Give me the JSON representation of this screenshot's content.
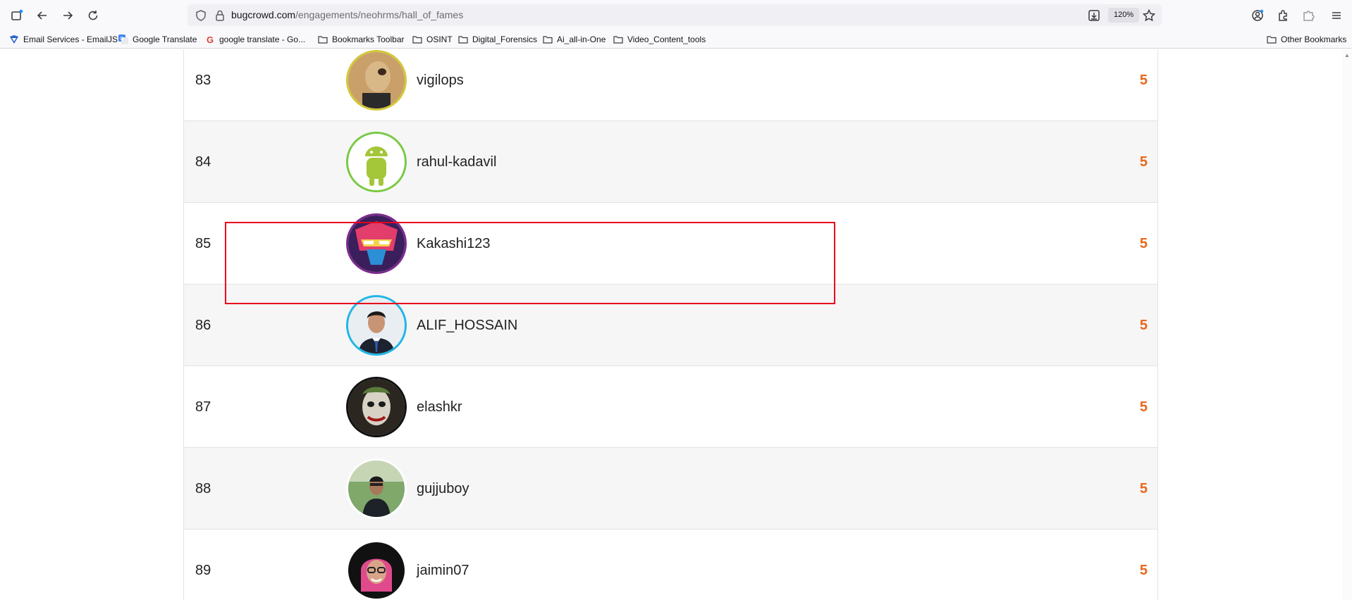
{
  "browser": {
    "url_host": "bugcrowd.com",
    "url_path": "/engagements/neohrms/hall_of_fames",
    "zoom": "120%"
  },
  "bookmarks": [
    {
      "label": "Email Services - EmailJS",
      "icon": "emailjs-icon"
    },
    {
      "label": "Google Translate",
      "icon": "google-translate-icon"
    },
    {
      "label": "google translate - Go...",
      "icon": "google-icon"
    },
    {
      "label": "Bookmarks Toolbar",
      "icon": "folder-icon"
    },
    {
      "label": "OSINT",
      "icon": "folder-icon"
    },
    {
      "label": "Digital_Forensics",
      "icon": "folder-icon"
    },
    {
      "label": "Ai_all-in-One",
      "icon": "folder-icon"
    },
    {
      "label": "Video_Content_tools",
      "icon": "folder-icon"
    }
  ],
  "other_bookmarks": "Other Bookmarks",
  "leaderboard": {
    "points_color": "#e8671b",
    "highlight_color": "#e8001c",
    "rows": [
      {
        "rank": "83",
        "username": "vigilops",
        "points": "5",
        "ring": "#d3c83a"
      },
      {
        "rank": "84",
        "username": "rahul-kadavil",
        "points": "5",
        "ring": "#7ac943"
      },
      {
        "rank": "85",
        "username": "Kakashi123",
        "points": "5",
        "ring": "#7b2a8c"
      },
      {
        "rank": "86",
        "username": "ALIF_HOSSAIN",
        "points": "5",
        "ring": "#1fb6e8"
      },
      {
        "rank": "87",
        "username": "elashkr",
        "points": "5",
        "ring": "#111111"
      },
      {
        "rank": "88",
        "username": "gujjuboy",
        "points": "5",
        "ring": "#ffffff"
      },
      {
        "rank": "89",
        "username": "jaimin07",
        "points": "5",
        "ring": "#ffffff"
      }
    ]
  }
}
